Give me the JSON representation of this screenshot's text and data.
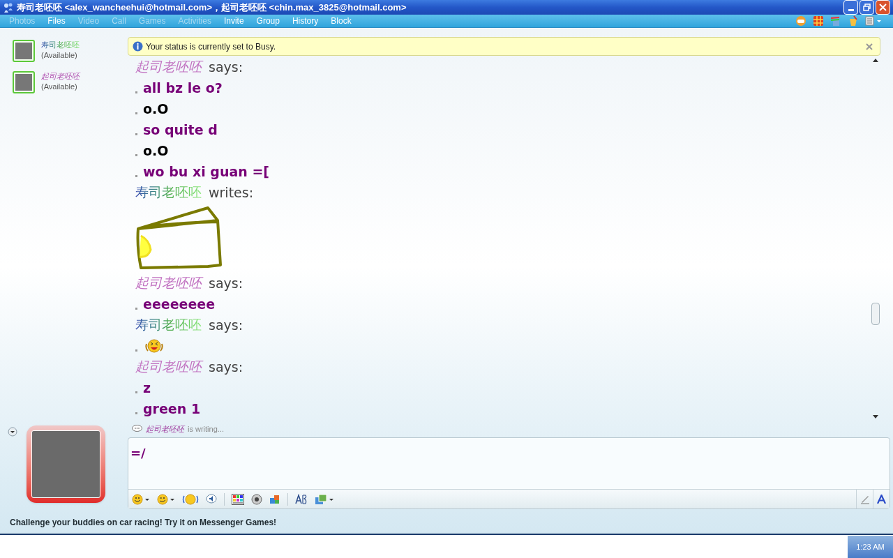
{
  "window": {
    "title": "寿司老呸呸 <alex_wancheehui@hotmail.com>，起司老呸呸 <chin.max_3825@hotmail.com>"
  },
  "menu": [
    {
      "label": "Photos",
      "disabled": true
    },
    {
      "label": "Files",
      "disabled": false
    },
    {
      "label": "Video",
      "disabled": true
    },
    {
      "label": "Call",
      "disabled": true
    },
    {
      "label": "Games",
      "disabled": true
    },
    {
      "label": "Activities",
      "disabled": true
    },
    {
      "label": "Invite",
      "disabled": false
    },
    {
      "label": "Group",
      "disabled": false
    },
    {
      "label": "History",
      "disabled": false
    },
    {
      "label": "Block",
      "disabled": false
    }
  ],
  "contacts": [
    {
      "name": "寿司老呸呸",
      "italic": false,
      "status": "(Available)"
    },
    {
      "name": "起司老呸呸",
      "italic": true,
      "status": "(Available)"
    }
  ],
  "notification": {
    "text": "Your status is currently set to Busy."
  },
  "messages": [
    {
      "kind": "header",
      "sender": "起司老呸呸",
      "italic": true,
      "verb": "says:"
    },
    {
      "kind": "line",
      "text": "all bz le o?",
      "color": "#770077"
    },
    {
      "kind": "line",
      "text": "o.O",
      "color": "#000000"
    },
    {
      "kind": "line",
      "text": "so quite d",
      "color": "#770077"
    },
    {
      "kind": "line",
      "text": "o.O",
      "color": "#000000"
    },
    {
      "kind": "line",
      "text": "wo bu xi guan =[",
      "color": "#770077"
    },
    {
      "kind": "header",
      "sender": "寿司老呸呸",
      "italic": false,
      "verb": "writes:"
    },
    {
      "kind": "ink"
    },
    {
      "kind": "header",
      "sender": "起司老呸呸",
      "italic": true,
      "verb": "says:"
    },
    {
      "kind": "line",
      "text": "eeeeeeee",
      "color": "#770077"
    },
    {
      "kind": "header",
      "sender": "寿司老呸呸",
      "italic": false,
      "verb": "says:"
    },
    {
      "kind": "emoticon"
    },
    {
      "kind": "header",
      "sender": "起司老呸呸",
      "italic": true,
      "verb": "says:"
    },
    {
      "kind": "line",
      "text": "z",
      "color": "#770077"
    },
    {
      "kind": "line",
      "text": "green 1",
      "color": "#770077"
    }
  ],
  "typing": {
    "sender": "起司老呸呸",
    "text": "is writing..."
  },
  "input": {
    "value": "=/"
  },
  "status_bar": {
    "text": "Challenge your buddies on car racing! Try it on Messenger Games!"
  },
  "taskbar": {
    "clock": "1:23 AM"
  }
}
